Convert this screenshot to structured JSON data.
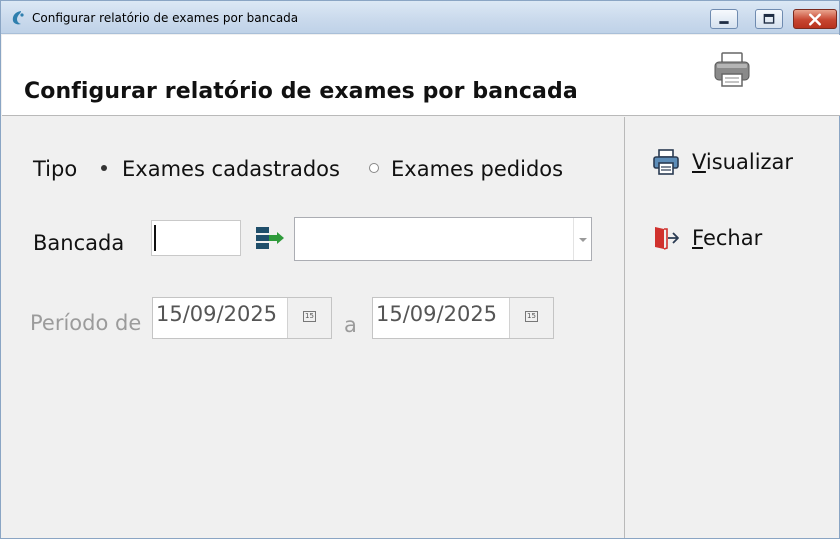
{
  "window": {
    "title": "Configurar relatório de exames por bancada",
    "icon": "app-leaf-icon"
  },
  "header": {
    "title": "Configurar relatório de exames por bancada",
    "icon": "printer-icon"
  },
  "form": {
    "tipo_label": "Tipo",
    "tipo_options": [
      {
        "label": "Exames cadastrados",
        "selected": true
      },
      {
        "label": "Exames pedidos",
        "selected": false
      }
    ],
    "bancada_label": "Bancada",
    "bancada_code": "",
    "bancada_select_value": "",
    "periodo_label": "Período de",
    "periodo_from": "15/09/2025",
    "periodo_sep": "a",
    "periodo_to": "15/09/2025",
    "calendar_glyph": "15"
  },
  "sidebar": {
    "visualizar_mnemonic": "V",
    "visualizar_rest": "isualizar",
    "fechar_mnemonic": "F",
    "fechar_rest": "echar"
  },
  "colors": {
    "title_bar": "#c9d9ec",
    "close_button": "#c74631",
    "search_icon_green": "#2e9a3a",
    "search_icon_dark": "#1f4e6a",
    "exit_icon_red": "#d0312d"
  }
}
